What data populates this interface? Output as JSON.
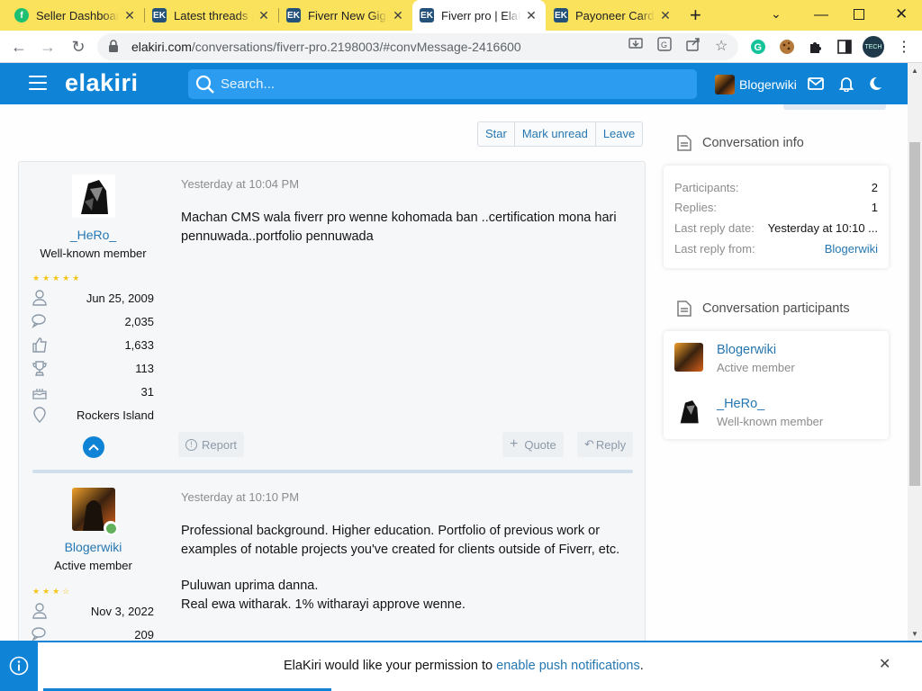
{
  "browser": {
    "tabs": [
      {
        "title": "Seller Dashboard",
        "favicon": "fiverr-favicon",
        "color": "#1dbf73",
        "letter": "fi",
        "active": false
      },
      {
        "title": "Latest threads | Ela",
        "favicon": "elakiri-favicon",
        "color": "#24517a",
        "letter": "EK",
        "active": false
      },
      {
        "title": "Fiverr New Gig Po",
        "favicon": "elakiri-favicon",
        "color": "#24517a",
        "letter": "EK",
        "active": false
      },
      {
        "title": "Fiverr pro | ElaKiri",
        "favicon": "elakiri-favicon",
        "color": "#24517a",
        "letter": "EK",
        "active": true
      },
      {
        "title": "Payoneer Card | E",
        "favicon": "elakiri-favicon",
        "color": "#24517a",
        "letter": "EK",
        "active": false
      }
    ],
    "new_tab_label": "+",
    "url_host": "elakiri.com",
    "url_path": "/conversations/fiverr-pro.2198003/#convMessage-2416600",
    "profile_label": "TECH"
  },
  "site": {
    "logo": "elakiri",
    "search_placeholder": "Search...",
    "username": "Blogerwiki",
    "accent": "#0f83d6"
  },
  "actions": {
    "star": "Star",
    "mark_unread": "Mark unread",
    "leave": "Leave"
  },
  "messages": [
    {
      "author": "_HeRo_",
      "role": "Well-known member",
      "stars": "★★★★★",
      "joined": "Jun 25, 2009",
      "posts": "2,035",
      "reactions": "1,633",
      "points": "113",
      "age": "31",
      "location": "Rockers Island",
      "date": "Yesterday at 10:04 PM",
      "text": "Machan CMS wala fiverr pro wenne kohomada ban ..certification mona hari pennuwada..portfolio pennuwada",
      "report": "Report",
      "quote": "Quote",
      "reply": "Reply"
    },
    {
      "author": "Blogerwiki",
      "role": "Active member",
      "stars": "★★★☆",
      "joined": "Nov 3, 2022",
      "posts": "209",
      "date": "Yesterday at 10:10 PM",
      "text1": "Professional background. Higher education. Portfolio of previous work or examples of notable projects you've created for clients outside of Fiverr, etc.",
      "text2": "Puluwan uprima danna.",
      "text3": "Real ewa witharak. 1% witharayi approve wenne."
    }
  ],
  "sidebar": {
    "info_title": "Conversation info",
    "info": {
      "participants_label": "Participants:",
      "participants": "2",
      "replies_label": "Replies:",
      "replies": "1",
      "last_reply_date_label": "Last reply date:",
      "last_reply_date": "Yesterday at 10:10 ...",
      "last_reply_from_label": "Last reply from:",
      "last_reply_from": "Blogerwiki"
    },
    "participants_title": "Conversation participants",
    "participants": [
      {
        "name": "Blogerwiki",
        "role": "Active member"
      },
      {
        "name": "_HeRo_",
        "role": "Well-known member"
      }
    ]
  },
  "notification": {
    "text": "ElaKiri would like your permission to ",
    "link": "enable push notifications",
    "end": "."
  }
}
